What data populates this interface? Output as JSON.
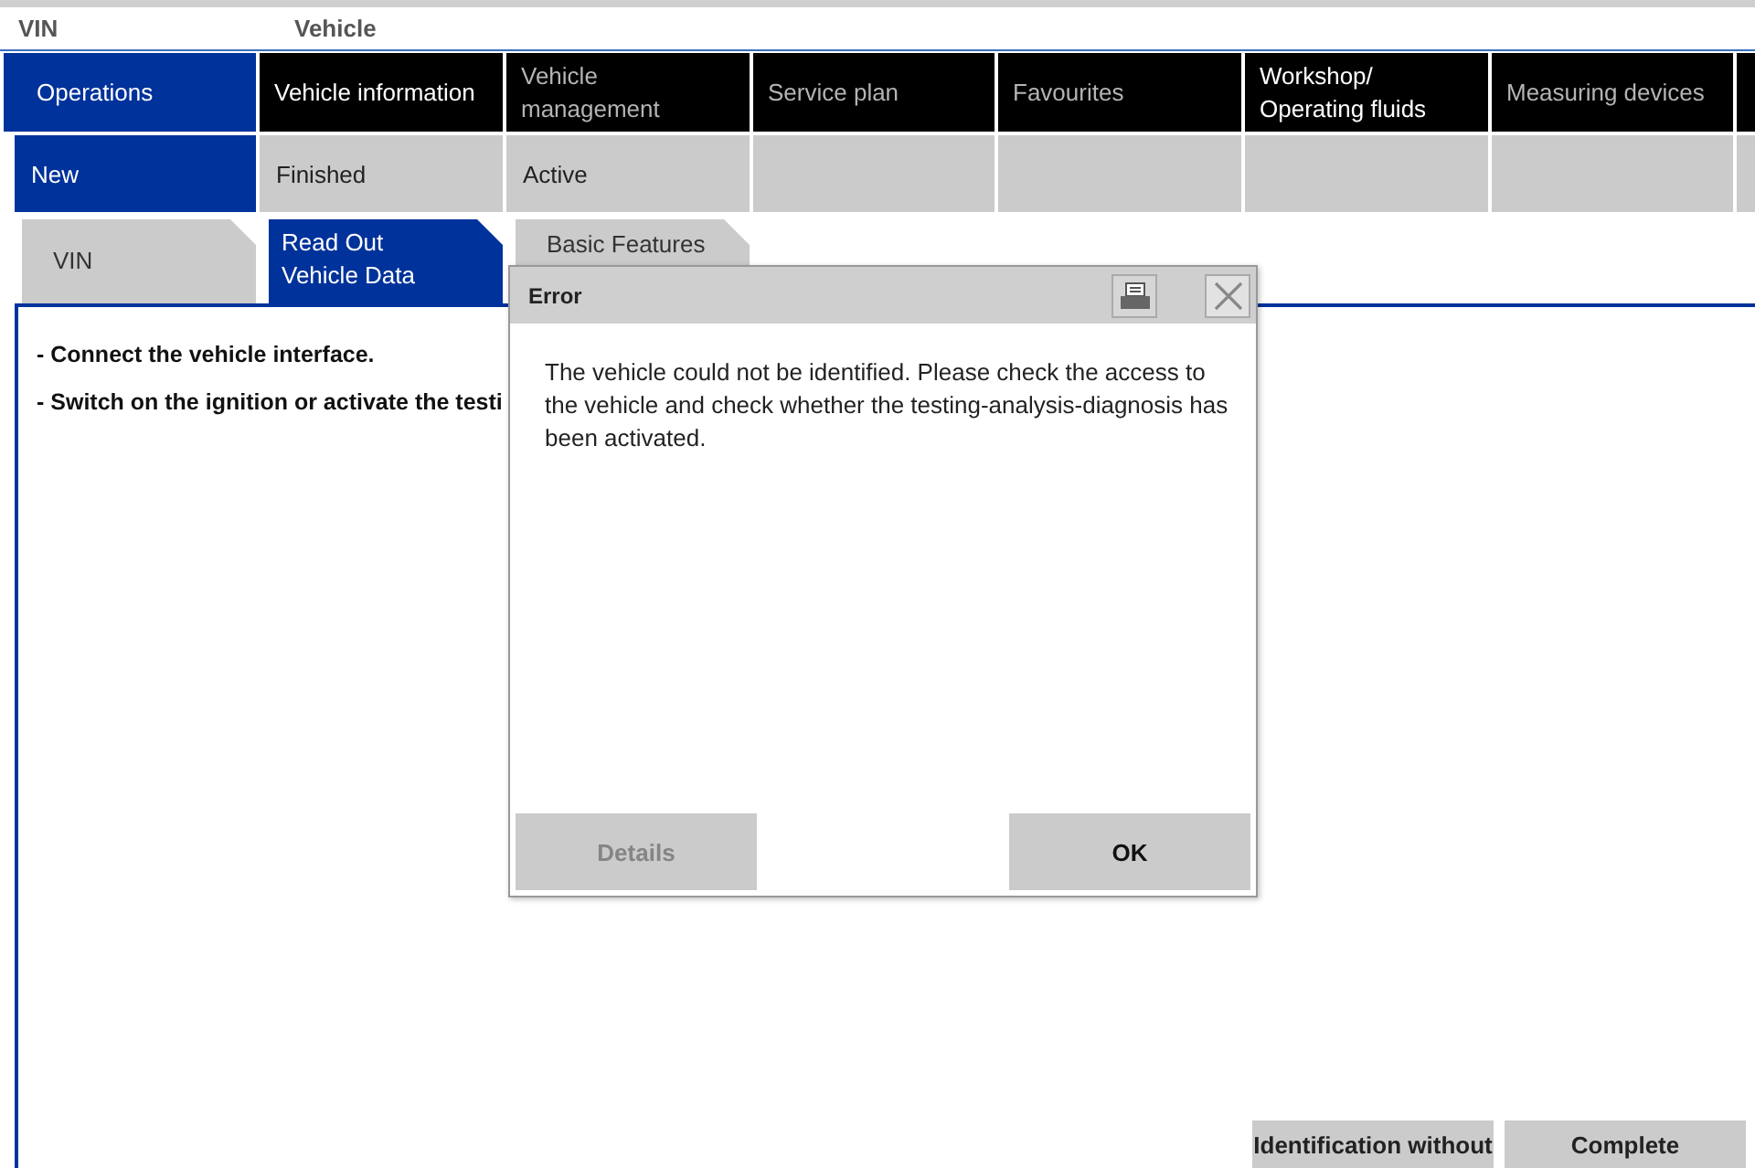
{
  "header": {
    "vin_label": "VIN",
    "vehicle_label": "Vehicle"
  },
  "main_tabs": [
    {
      "label": "Operations",
      "selected": true,
      "disabled": false
    },
    {
      "label": "Vehicle information",
      "selected": false,
      "disabled": false
    },
    {
      "label": "Vehicle\nmanagement",
      "selected": false,
      "disabled": true
    },
    {
      "label": "Service plan",
      "selected": false,
      "disabled": true
    },
    {
      "label": "Favourites",
      "selected": false,
      "disabled": true
    },
    {
      "label": "Workshop/\nOperating fluids",
      "selected": false,
      "disabled": false
    },
    {
      "label": "Measuring devices",
      "selected": false,
      "disabled": true
    }
  ],
  "sub_tabs": [
    {
      "label": "New",
      "selected": true
    },
    {
      "label": "Finished",
      "selected": false
    },
    {
      "label": "Active",
      "selected": false
    }
  ],
  "step_tabs": [
    {
      "label": "VIN",
      "selected": false
    },
    {
      "label": "Read Out\nVehicle Data",
      "selected": true
    },
    {
      "label": "Basic Features",
      "selected": false
    }
  ],
  "instructions": [
    "- Connect the vehicle interface.",
    "- Switch on the ignition or activate the testi"
  ],
  "footer_buttons": [
    {
      "label": "Identification without"
    },
    {
      "label": "Complete"
    }
  ],
  "dialog": {
    "title": "Error",
    "message": "The vehicle could not be identified. Please check the access to the vehicle and check whether the testing-analysis-diagnosis has been activated.",
    "buttons": [
      {
        "label": "Details",
        "disabled": true
      },
      {
        "label": "OK",
        "disabled": false
      }
    ]
  }
}
